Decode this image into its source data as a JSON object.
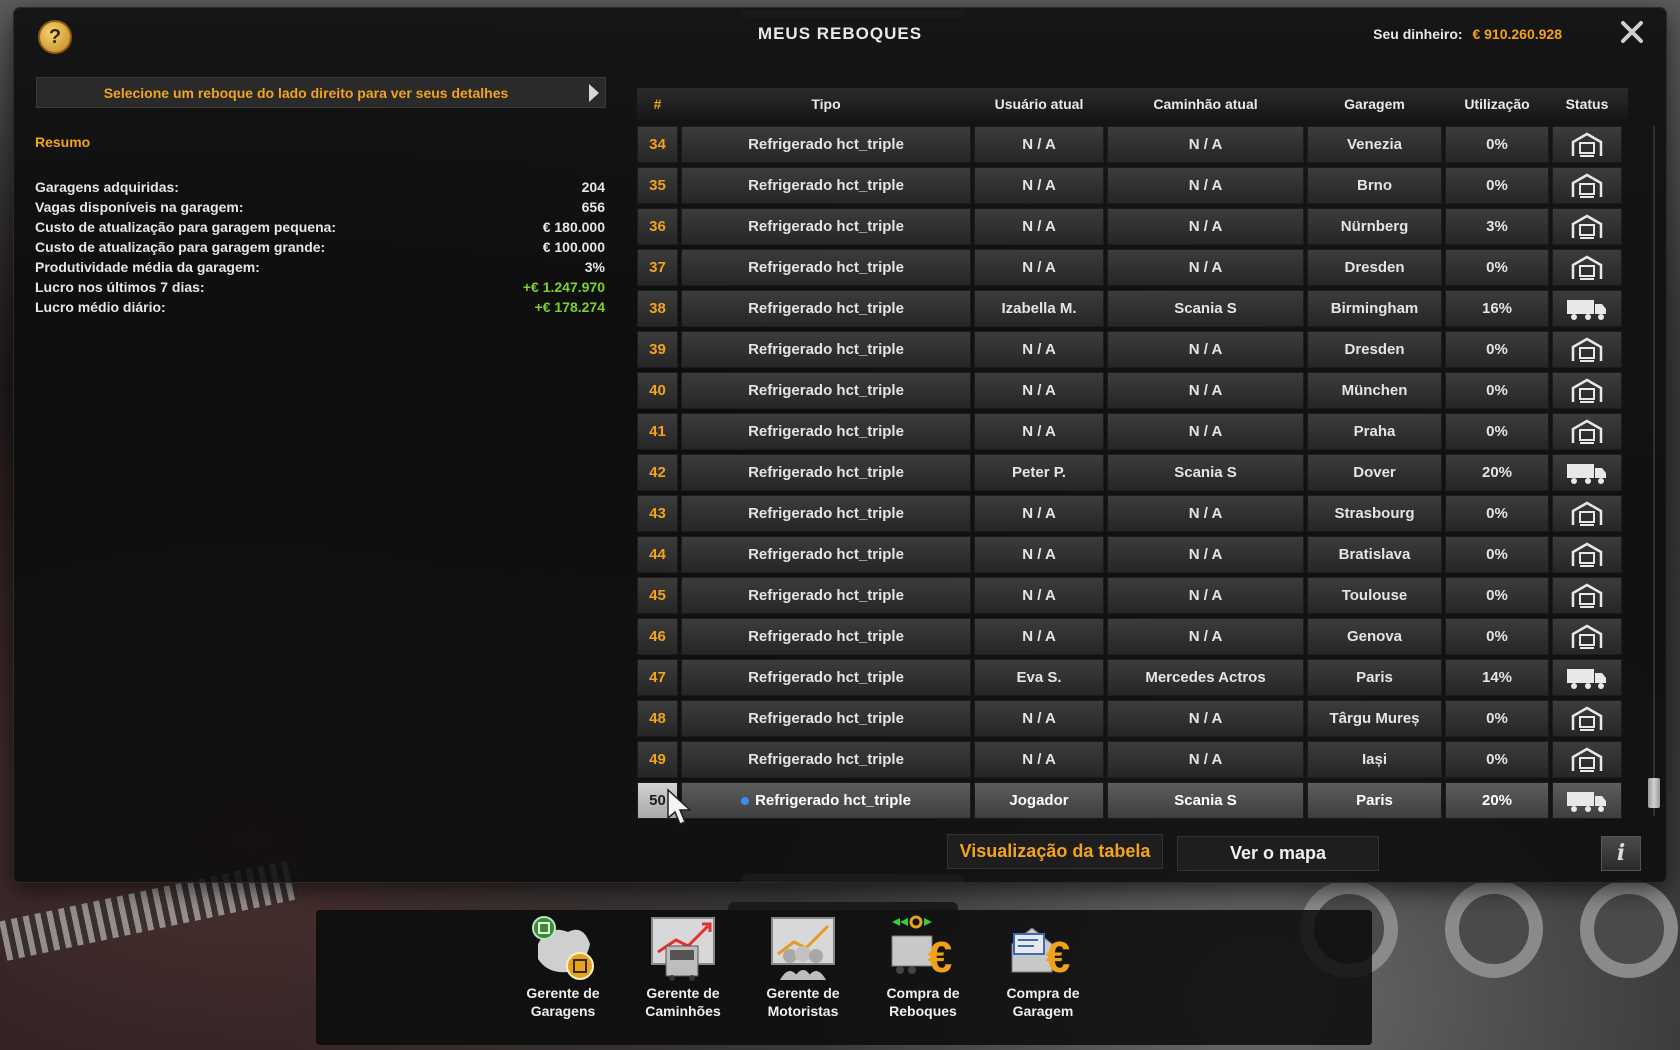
{
  "header": {
    "title": "MEUS REBOQUES",
    "money_label": "Seu dinheiro:",
    "money_value": "€ 910.260.928",
    "help_label": "?"
  },
  "left": {
    "hint": "Selecione um reboque do lado direito para ver seus detalhes",
    "summary_title": "Resumo",
    "summary": [
      {
        "label": "Garagens adquiridas:",
        "value": "204",
        "color": "white"
      },
      {
        "label": "Vagas disponíveis na garagem:",
        "value": "656",
        "color": "white"
      },
      {
        "label": "Custo de atualização para garagem pequena:",
        "value": "€ 180.000",
        "color": "white"
      },
      {
        "label": "Custo de atualização para garagem grande:",
        "value": "€ 100.000",
        "color": "white"
      },
      {
        "label": "Produtividade média da garagem:",
        "value": "3%",
        "color": "white"
      },
      {
        "label": "Lucro nos últimos 7 dias:",
        "value": "+€ 1.247.970",
        "color": "green"
      },
      {
        "label": "Lucro médio diário:",
        "value": "+€ 178.274",
        "color": "green"
      }
    ]
  },
  "table": {
    "columns": [
      "#",
      "Tipo",
      "Usuário atual",
      "Caminhão atual",
      "Garagem",
      "Utilização",
      "Status"
    ],
    "rows": [
      {
        "num": "34",
        "tipo": "Refrigerado hct_triple",
        "user": "N / A",
        "truck": "N / A",
        "garage": "Venezia",
        "util": "0%",
        "status": "garage-icon"
      },
      {
        "num": "35",
        "tipo": "Refrigerado hct_triple",
        "user": "N / A",
        "truck": "N / A",
        "garage": "Brno",
        "util": "0%",
        "status": "garage-icon"
      },
      {
        "num": "36",
        "tipo": "Refrigerado hct_triple",
        "user": "N / A",
        "truck": "N / A",
        "garage": "Nürnberg",
        "util": "3%",
        "status": "garage-icon"
      },
      {
        "num": "37",
        "tipo": "Refrigerado hct_triple",
        "user": "N / A",
        "truck": "N / A",
        "garage": "Dresden",
        "util": "0%",
        "status": "garage-icon"
      },
      {
        "num": "38",
        "tipo": "Refrigerado hct_triple",
        "user": "Izabella M.",
        "truck": "Scania S",
        "garage": "Birmingham",
        "util": "16%",
        "status": "truck-icon"
      },
      {
        "num": "39",
        "tipo": "Refrigerado hct_triple",
        "user": "N / A",
        "truck": "N / A",
        "garage": "Dresden",
        "util": "0%",
        "status": "garage-icon"
      },
      {
        "num": "40",
        "tipo": "Refrigerado hct_triple",
        "user": "N / A",
        "truck": "N / A",
        "garage": "München",
        "util": "0%",
        "status": "garage-icon"
      },
      {
        "num": "41",
        "tipo": "Refrigerado hct_triple",
        "user": "N / A",
        "truck": "N / A",
        "garage": "Praha",
        "util": "0%",
        "status": "garage-icon"
      },
      {
        "num": "42",
        "tipo": "Refrigerado hct_triple",
        "user": "Peter P.",
        "truck": "Scania S",
        "garage": "Dover",
        "util": "20%",
        "status": "truck-icon"
      },
      {
        "num": "43",
        "tipo": "Refrigerado hct_triple",
        "user": "N / A",
        "truck": "N / A",
        "garage": "Strasbourg",
        "util": "0%",
        "status": "garage-icon"
      },
      {
        "num": "44",
        "tipo": "Refrigerado hct_triple",
        "user": "N / A",
        "truck": "N / A",
        "garage": "Bratislava",
        "util": "0%",
        "status": "garage-icon"
      },
      {
        "num": "45",
        "tipo": "Refrigerado hct_triple",
        "user": "N / A",
        "truck": "N / A",
        "garage": "Toulouse",
        "util": "0%",
        "status": "garage-icon"
      },
      {
        "num": "46",
        "tipo": "Refrigerado hct_triple",
        "user": "N / A",
        "truck": "N / A",
        "garage": "Genova",
        "util": "0%",
        "status": "garage-icon"
      },
      {
        "num": "47",
        "tipo": "Refrigerado hct_triple",
        "user": "Eva S.",
        "truck": "Mercedes Actros",
        "garage": "Paris",
        "util": "14%",
        "status": "truck-icon"
      },
      {
        "num": "48",
        "tipo": "Refrigerado hct_triple",
        "user": "N / A",
        "truck": "N / A",
        "garage": "Târgu Mureș",
        "util": "0%",
        "status": "garage-icon"
      },
      {
        "num": "49",
        "tipo": "Refrigerado hct_triple",
        "user": "N / A",
        "truck": "N / A",
        "garage": "Iași",
        "util": "0%",
        "status": "garage-icon"
      },
      {
        "num": "50",
        "tipo": "Refrigerado hct_triple",
        "user": "Jogador",
        "truck": "Scania S",
        "garage": "Paris",
        "util": "20%",
        "status": "truck-icon",
        "selected": true
      }
    ]
  },
  "buttons": {
    "table_view": "Visualização da tabela",
    "map_view": "Ver o mapa",
    "info": "i"
  },
  "bottom_menu": [
    {
      "line1": "Gerente de",
      "line2": "Garagens",
      "icon": "garage-manager-icon"
    },
    {
      "line1": "Gerente de",
      "line2": "Caminhões",
      "icon": "truck-manager-icon"
    },
    {
      "line1": "Gerente de",
      "line2": "Motoristas",
      "icon": "driver-manager-icon"
    },
    {
      "line1": "Compra de",
      "line2": "Reboques",
      "icon": "trailer-purchase-icon"
    },
    {
      "line1": "Compra de",
      "line2": "Garagem",
      "icon": "garage-purchase-icon"
    }
  ],
  "colors": {
    "accent": "#f3a31c",
    "profit": "#7bd22b",
    "selected_dot": "#3a8cf0"
  }
}
